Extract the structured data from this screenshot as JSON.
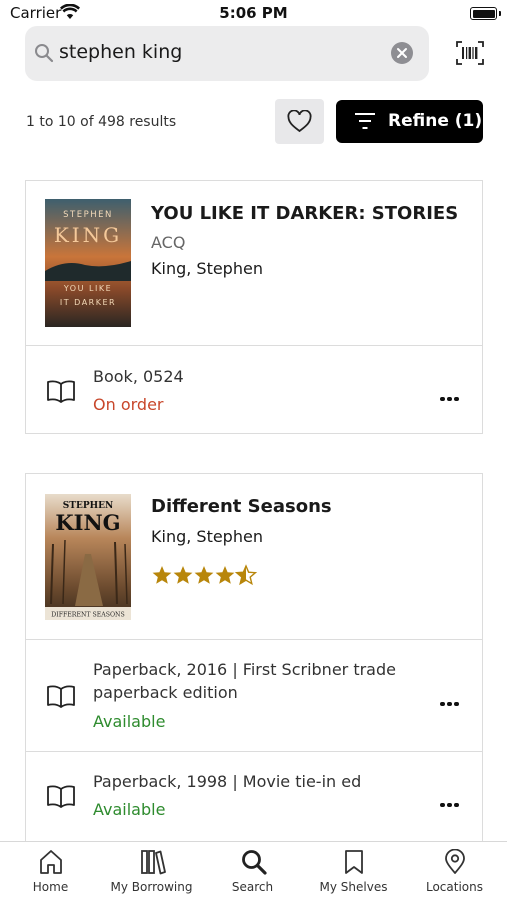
{
  "status_bar": {
    "carrier": "Carrier",
    "time": "5:06 PM"
  },
  "search": {
    "query": "stephen king"
  },
  "results": {
    "count_text": "1 to 10 of 498 results",
    "refine_label": "Refine (1)"
  },
  "items": [
    {
      "title": "YOU LIKE IT DARKER: STORIES",
      "subtitle": "ACQ",
      "author": "King, Stephen",
      "cover": {
        "top": "STEPHEN",
        "mid": "KING",
        "line1": "YOU LIKE",
        "line2": "IT DARKER"
      },
      "formats": [
        {
          "label": "Book, 0524",
          "status": "On order",
          "status_color": "#c8472b"
        }
      ]
    },
    {
      "title": "Different Seasons",
      "author": "King, Stephen",
      "rating": 4.5,
      "cover": {
        "top": "STEPHEN",
        "mid": "KING",
        "bottom": "DIFFERENT SEASONS"
      },
      "formats": [
        {
          "label": "Paperback, 2016 | First Scribner trade paperback edition",
          "status": "Available",
          "status_color": "#2e8b2e"
        },
        {
          "label": "Paperback, 1998 | Movie tie-in ed",
          "status": "Available",
          "status_color": "#2e8b2e"
        }
      ]
    }
  ],
  "tabs": [
    {
      "label": "Home",
      "icon": "home-icon"
    },
    {
      "label": "My Borrowing",
      "icon": "books-icon"
    },
    {
      "label": "Search",
      "icon": "search-icon"
    },
    {
      "label": "My Shelves",
      "icon": "bookmark-icon"
    },
    {
      "label": "Locations",
      "icon": "location-pin-icon"
    }
  ],
  "colors": {
    "accent": "#000000",
    "star": "#b8860b",
    "on_order": "#c8472b",
    "available": "#2e8b2e"
  }
}
